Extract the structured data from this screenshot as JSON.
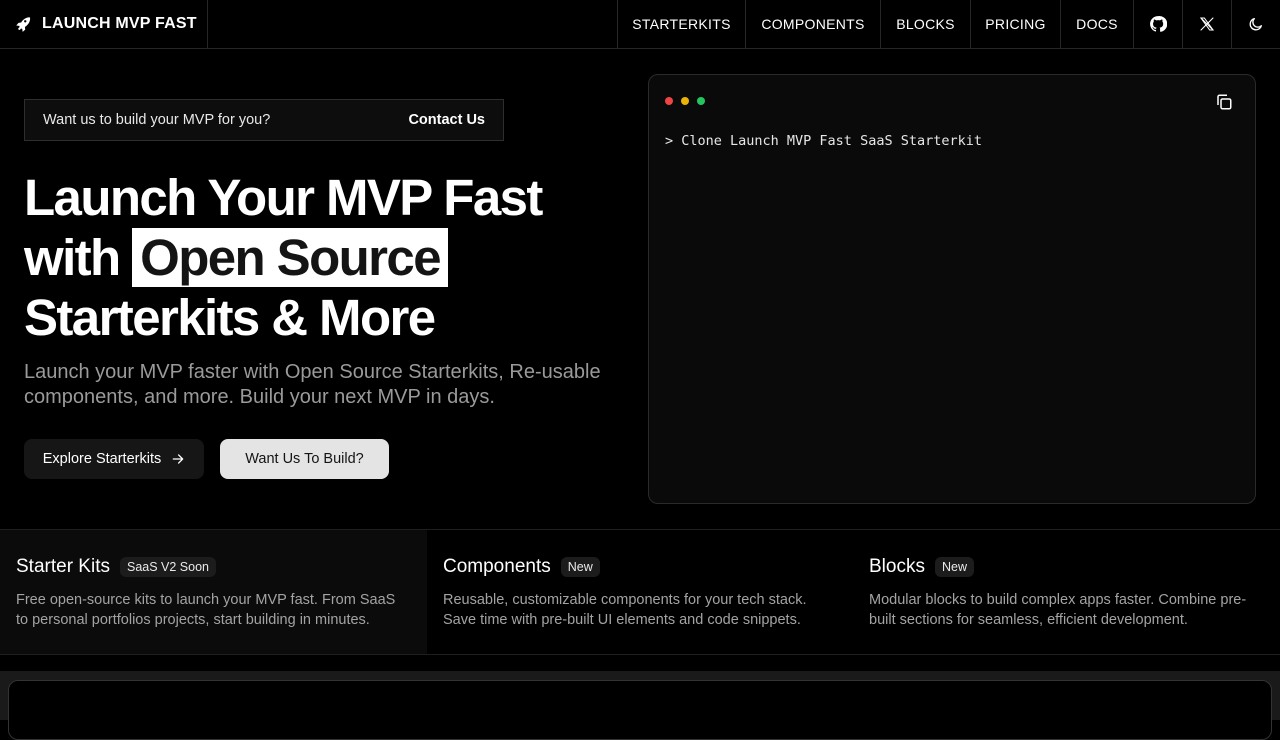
{
  "nav": {
    "brand": "LAUNCH MVP FAST",
    "brand_icon": "rocket-icon",
    "links": [
      "STARTERKITS",
      "COMPONENTS",
      "BLOCKS",
      "PRICING",
      "DOCS"
    ],
    "icons": [
      "github-icon",
      "x-icon",
      "theme-toggle-icon"
    ]
  },
  "banner": {
    "text": "Want us to build your MVP for you?",
    "link": "Contact Us"
  },
  "hero": {
    "line1": "Launch Your MVP Fast",
    "line2_prefix": "with",
    "line2_highlight": "Open Source",
    "line3": "Starterkits & More",
    "subtitle": "Launch your MVP faster with Open Source Starterkits, Re-usable components, and more. Build your next MVP in days.",
    "primary_button": "Explore Starterkits",
    "secondary_button": "Want Us To Build?"
  },
  "terminal": {
    "dot_colors": [
      "#ef4444",
      "#eab308",
      "#22c55e"
    ],
    "line": "> Clone Launch MVP Fast SaaS Starterkit"
  },
  "features": [
    {
      "title": "Starter Kits",
      "badge": "SaaS V2 Soon",
      "description": "Free open-source kits to launch your MVP fast. From SaaS to personal portfolios projects, start building in minutes."
    },
    {
      "title": "Components",
      "badge": "New",
      "description": "Reusable, customizable components for your tech stack. Save time with pre-built UI elements and code snippets."
    },
    {
      "title": "Blocks",
      "badge": "New",
      "description": "Modular blocks to build complex apps faster. Combine pre-built sections for seamless, efficient development."
    }
  ],
  "colors": {
    "background": "#000000",
    "highlight_bg": "#ffffff",
    "secondary_button_bg": "#e4e4e4",
    "muted_text": "#9a9a9a"
  }
}
